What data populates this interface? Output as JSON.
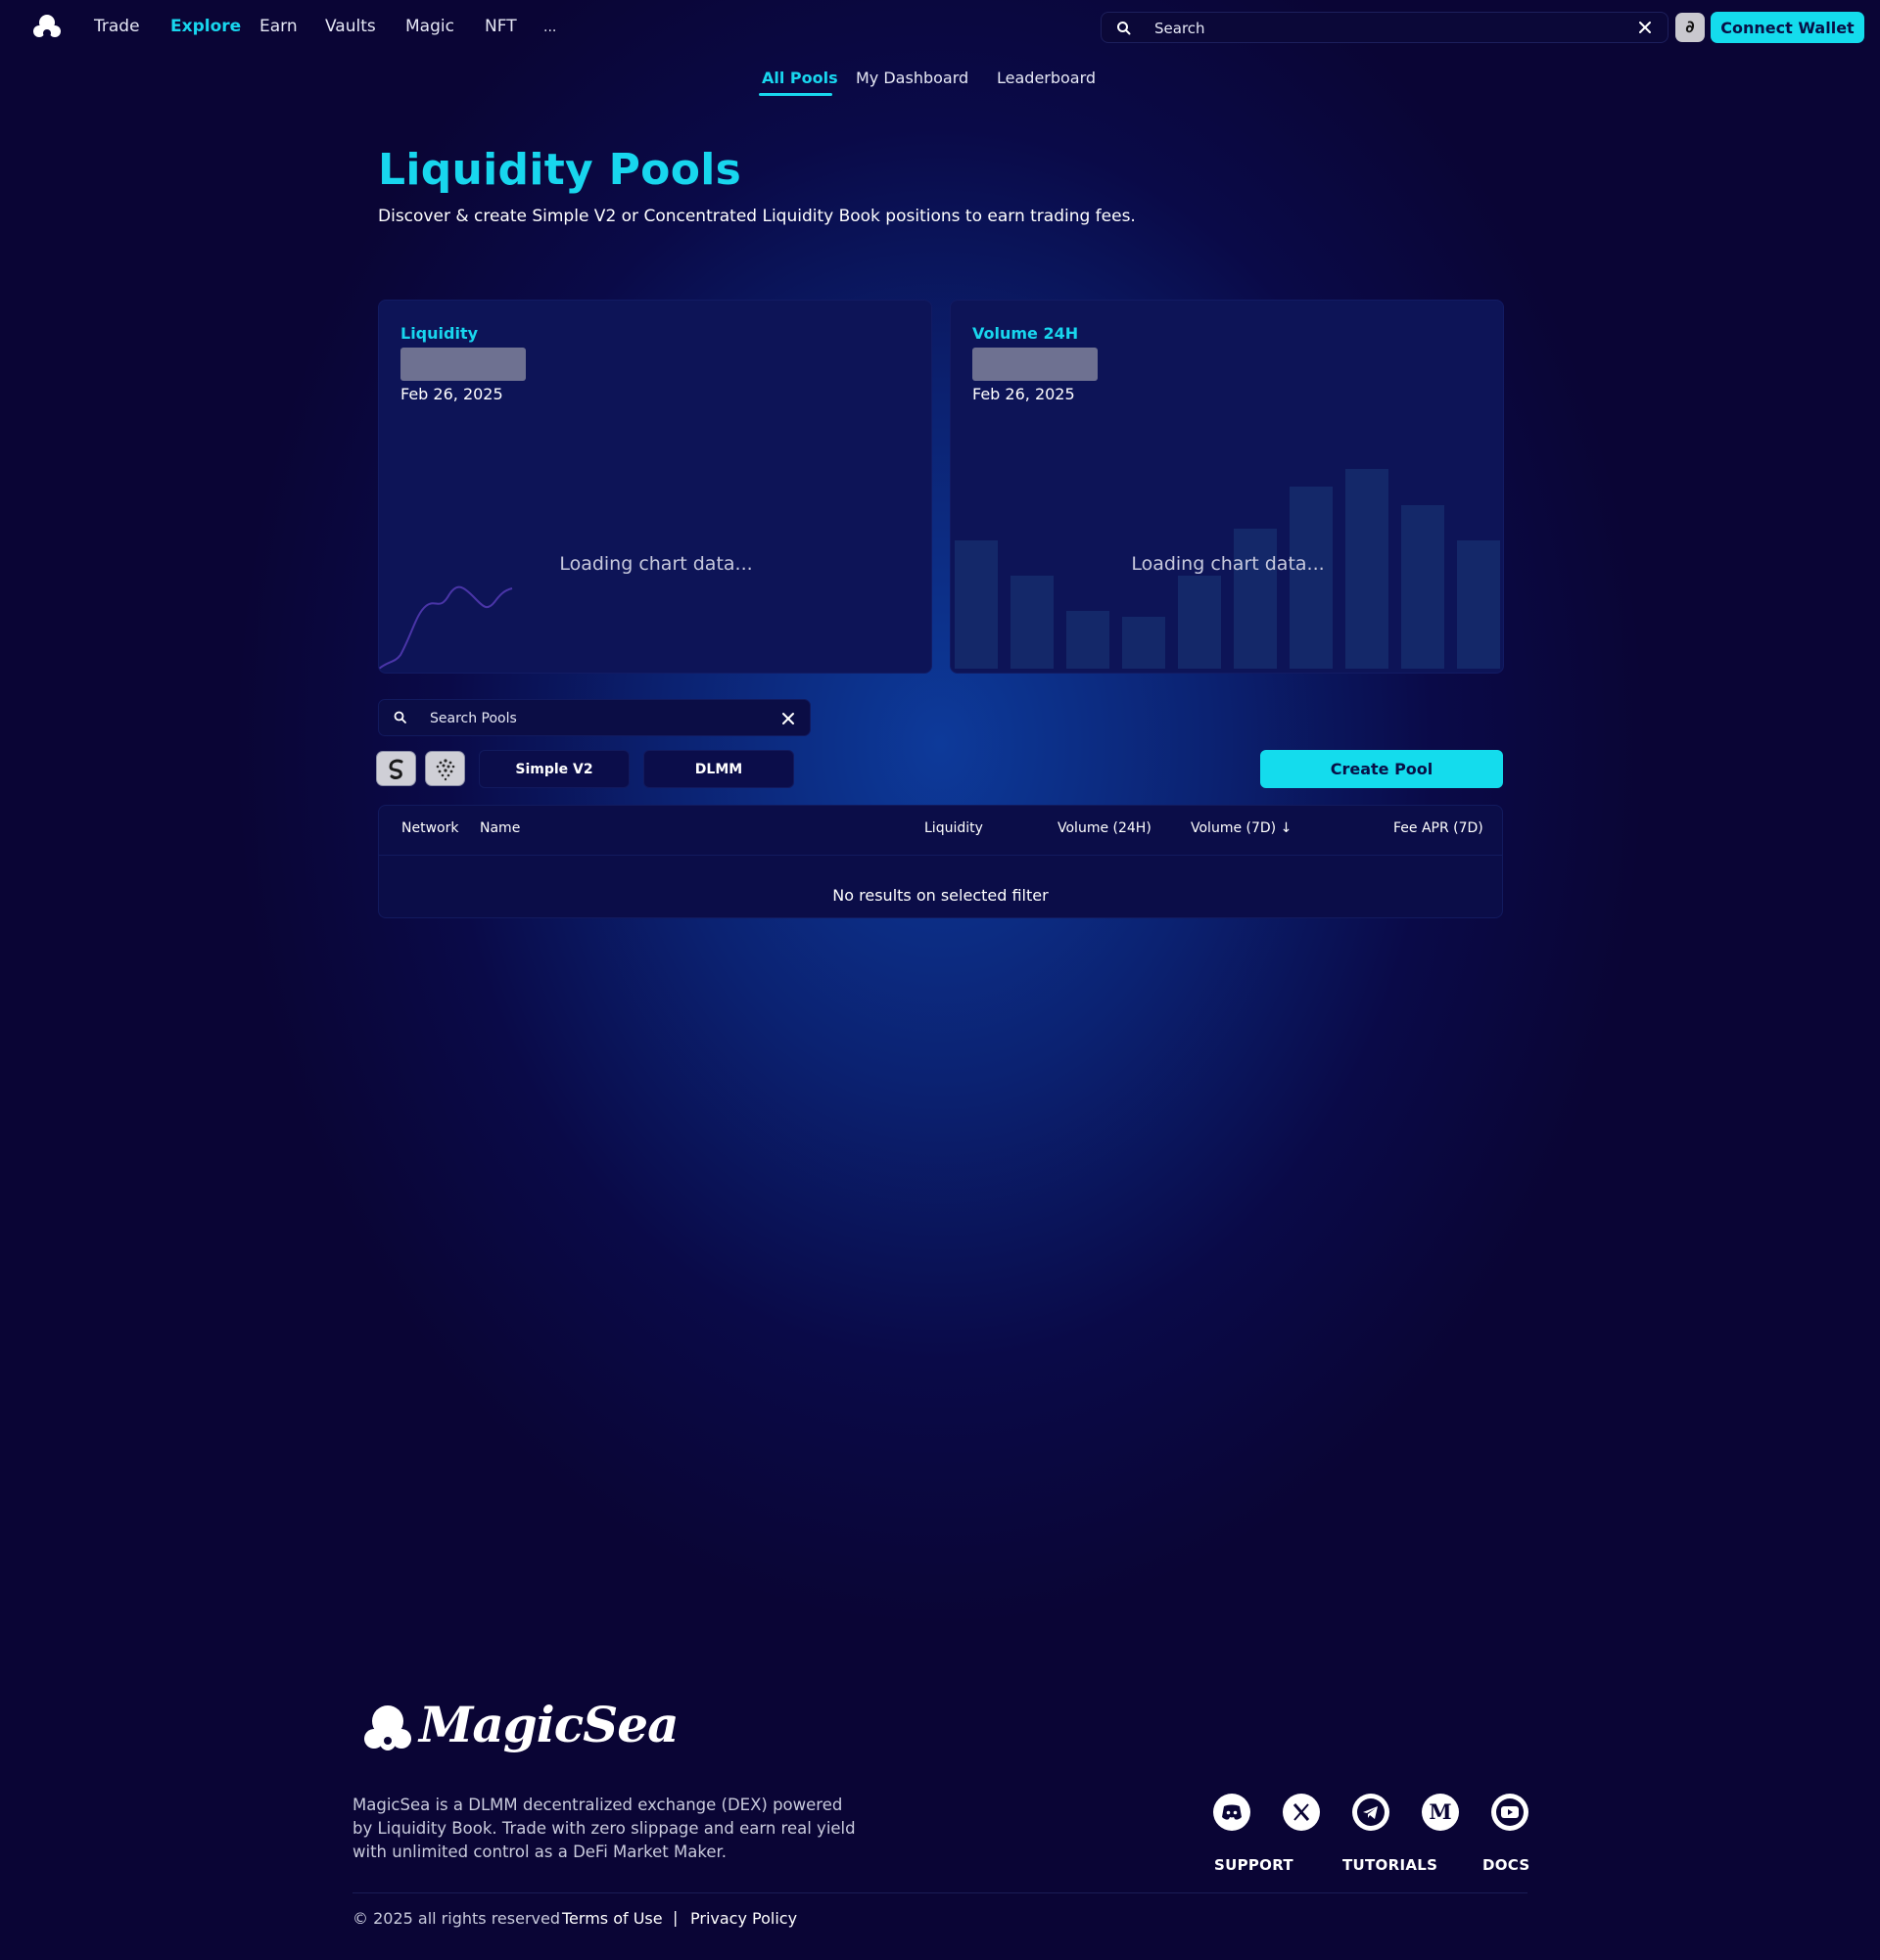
{
  "nav": {
    "items": [
      "Trade",
      "Explore",
      "Earn",
      "Vaults",
      "Magic",
      "NFT",
      "..."
    ],
    "active": "Explore",
    "search_placeholder": "Search",
    "network_chip": "∂",
    "connect_label": "Connect Wallet"
  },
  "subtabs": [
    "All Pools",
    "My Dashboard",
    "Leaderboard"
  ],
  "header": {
    "title": "Liquidity Pools",
    "subtitle": "Discover & create Simple V2 or Concentrated Liquidity Book positions to earn trading fees."
  },
  "cards": {
    "liquidity": {
      "label": "Liquidity",
      "date": "Feb 26, 2025",
      "loading": "Loading chart data..."
    },
    "volume": {
      "label": "Volume 24H",
      "date": "Feb 26, 2025",
      "loading": "Loading chart data..."
    }
  },
  "pool_search": {
    "placeholder": "Search Pools"
  },
  "filters": {
    "simple_v2": "Simple V2",
    "dlmm": "DLMM",
    "create_pool": "Create Pool"
  },
  "table": {
    "columns": [
      "Network",
      "Name",
      "Liquidity",
      "Volume (24H)",
      "Volume (7D) ↓",
      "Fee APR (7D)"
    ],
    "empty_message": "No results on selected filter"
  },
  "footer": {
    "logo_text": "MagicSea",
    "description": "MagicSea is a DLMM decentralized exchange (DEX) powered by Liquidity Book. Trade with zero slippage and earn real yield with unlimited control as a DeFi Market Maker.",
    "social_icons": [
      "discord-icon",
      "x-icon",
      "telegram-icon",
      "medium-icon",
      "youtube-icon"
    ],
    "links": [
      "SUPPORT",
      "TUTORIALS",
      "DOCS"
    ],
    "copyright": "© 2025 all rights reserved",
    "terms": "Terms of Use",
    "separator": "|",
    "privacy": "Privacy Policy"
  },
  "colors": {
    "accent": "#18d6ee",
    "background": "#0a0535",
    "card": "#0d1457"
  }
}
